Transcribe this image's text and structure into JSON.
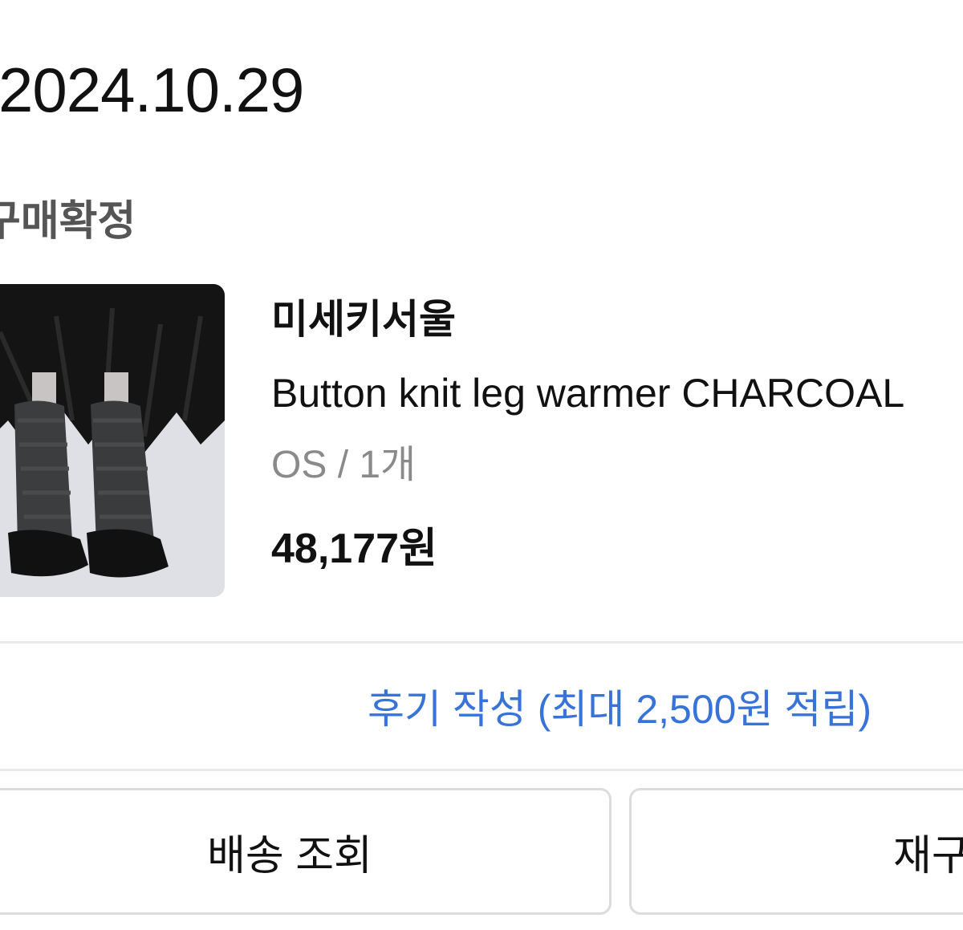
{
  "order": {
    "date": "2024.10.29",
    "status": "구매확정"
  },
  "product": {
    "image_icon": "leg-warmer-photo",
    "brand": "미세키서울",
    "name": "Button knit leg warmer CHARCOAL",
    "option": "OS / 1개",
    "price": "48,177원"
  },
  "review": {
    "label": "후기 작성 (최대 2,500원 적립)"
  },
  "actions": {
    "track_label": "배송 조회",
    "reorder_label": "재구매"
  },
  "colors": {
    "link": "#3873d8",
    "text": "#111111",
    "muted": "#8a8a8a",
    "border": "#dcdcdc"
  }
}
